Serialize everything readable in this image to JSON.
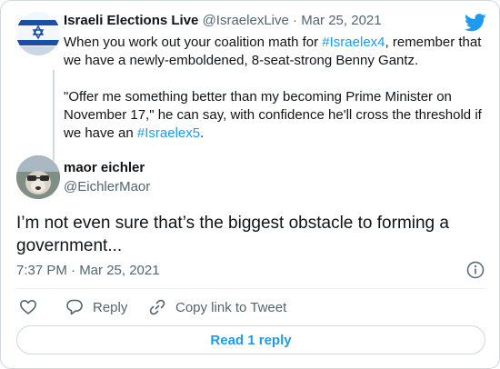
{
  "parent_tweet": {
    "display_name": "Israeli Elections Live",
    "handle": "@IsraelexLive",
    "separator": "·",
    "date": "Mar 25, 2021",
    "para1_a": "When you work out your coalition math for ",
    "hashtag1": "#Israelex4",
    "para1_b": ", remember that we have a newly-emboldened, 8-seat-strong Benny Gantz.",
    "para2_a": "\"Offer me something better than my becoming Prime Minister on November 17,\" he can say, with confidence he'll cross the threshold if we have an ",
    "hashtag2": "#Israelex5",
    "para2_b": "."
  },
  "reply_tweet": {
    "display_name": "maor eichler",
    "handle": "@EichlerMaor",
    "text": "I’m not even sure that’s the biggest obstacle to forming a government...",
    "timestamp": "7:37 PM · Mar 25, 2021"
  },
  "actions": {
    "reply_label": "Reply",
    "copy_link_label": "Copy link to Tweet"
  },
  "read_replies_label": "Read 1 reply",
  "colors": {
    "accent": "#1d9bf0",
    "muted": "#536471",
    "border": "#cfd9de"
  },
  "icons": [
    "israel-flag-avatar",
    "twitter-bird-icon",
    "info-icon",
    "heart-icon",
    "reply-bubble-icon",
    "link-icon"
  ]
}
